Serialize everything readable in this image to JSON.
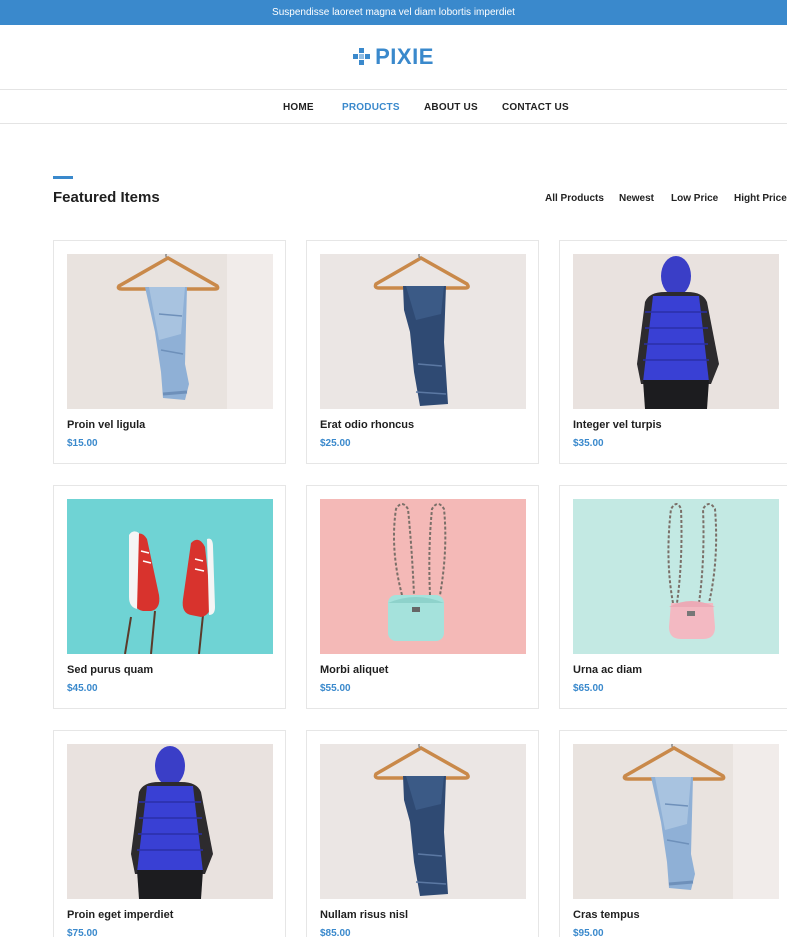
{
  "topbar": {
    "text": "Suspendisse laoreet magna vel diam lobortis imperdiet"
  },
  "brand": {
    "name": "PIXIE",
    "icon": "diamond-grid-icon",
    "color": "#3a89cc"
  },
  "nav": {
    "items": [
      {
        "label": "HOME",
        "active": false
      },
      {
        "label": "PRODUCTS",
        "active": true
      },
      {
        "label": "ABOUT US",
        "active": false
      },
      {
        "label": "CONTACT US",
        "active": false
      }
    ]
  },
  "section": {
    "title": "Featured Items",
    "filters": [
      "All Products",
      "Newest",
      "Low Price",
      "Hight Price"
    ]
  },
  "products": [
    {
      "name": "Proin vel ligula",
      "price": "$15.00",
      "image": "light-jeans-on-hanger"
    },
    {
      "name": "Erat odio rhoncus",
      "price": "$25.00",
      "image": "dark-jeans-on-hanger"
    },
    {
      "name": "Integer vel turpis",
      "price": "$35.00",
      "image": "blue-puffer-vest"
    },
    {
      "name": "Sed purus quam",
      "price": "$45.00",
      "image": "red-sneakers"
    },
    {
      "name": "Morbi aliquet",
      "price": "$55.00",
      "image": "mint-bag-on-pink"
    },
    {
      "name": "Urna ac diam",
      "price": "$65.00",
      "image": "pink-bag-on-mint"
    },
    {
      "name": "Proin eget imperdiet",
      "price": "$75.00",
      "image": "blue-puffer-vest"
    },
    {
      "name": "Nullam risus nisl",
      "price": "$85.00",
      "image": "dark-jeans-on-hanger"
    },
    {
      "name": "Cras tempus",
      "price": "$95.00",
      "image": "light-jeans-on-hanger"
    }
  ]
}
